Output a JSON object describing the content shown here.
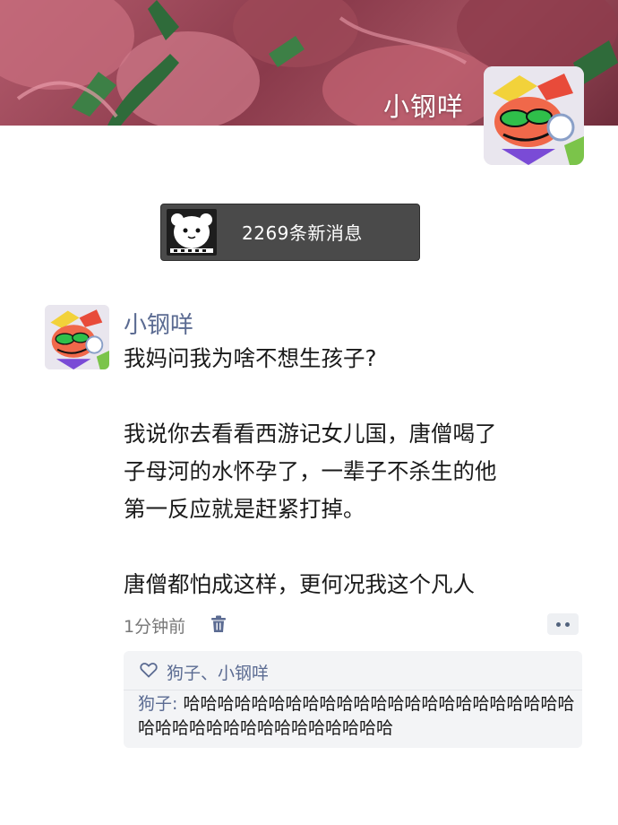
{
  "profile": {
    "name": "小钢咩",
    "cover_image": "pink-flower-cover",
    "avatar_image": "cartoon-character-avatar"
  },
  "notice": {
    "text": "2269条新消息",
    "thumb_image": "panda-thumbnail"
  },
  "post": {
    "author": "小钢咩",
    "lines": [
      "我妈问我为啥不想生孩子?",
      "",
      "我说你去看看西游记女儿国，唐僧喝了",
      "子母河的水怀孕了，一辈子不杀生的他",
      "第一反应就是赶紧打掉。",
      "",
      "唐僧都怕成这样，更何况我这个凡人"
    ],
    "time": "1分钟前",
    "delete_icon": "trash-icon",
    "more_icon": "more-dots-icon"
  },
  "interactions": {
    "likes": "狗子、小钢咩",
    "like_icon": "heart-icon",
    "comments": [
      {
        "author": "狗子",
        "separator": ": ",
        "text": "哈哈哈哈哈哈哈哈哈哈哈哈哈哈哈哈哈哈哈哈哈哈哈哈哈哈哈哈哈哈哈哈哈哈哈哈哈哈"
      }
    ]
  },
  "colors": {
    "link": "#5b6b92",
    "text": "#1a1a1a",
    "muted": "#777777",
    "notice_bg": "#4a4a4a",
    "comment_bg": "#f3f4f6"
  }
}
